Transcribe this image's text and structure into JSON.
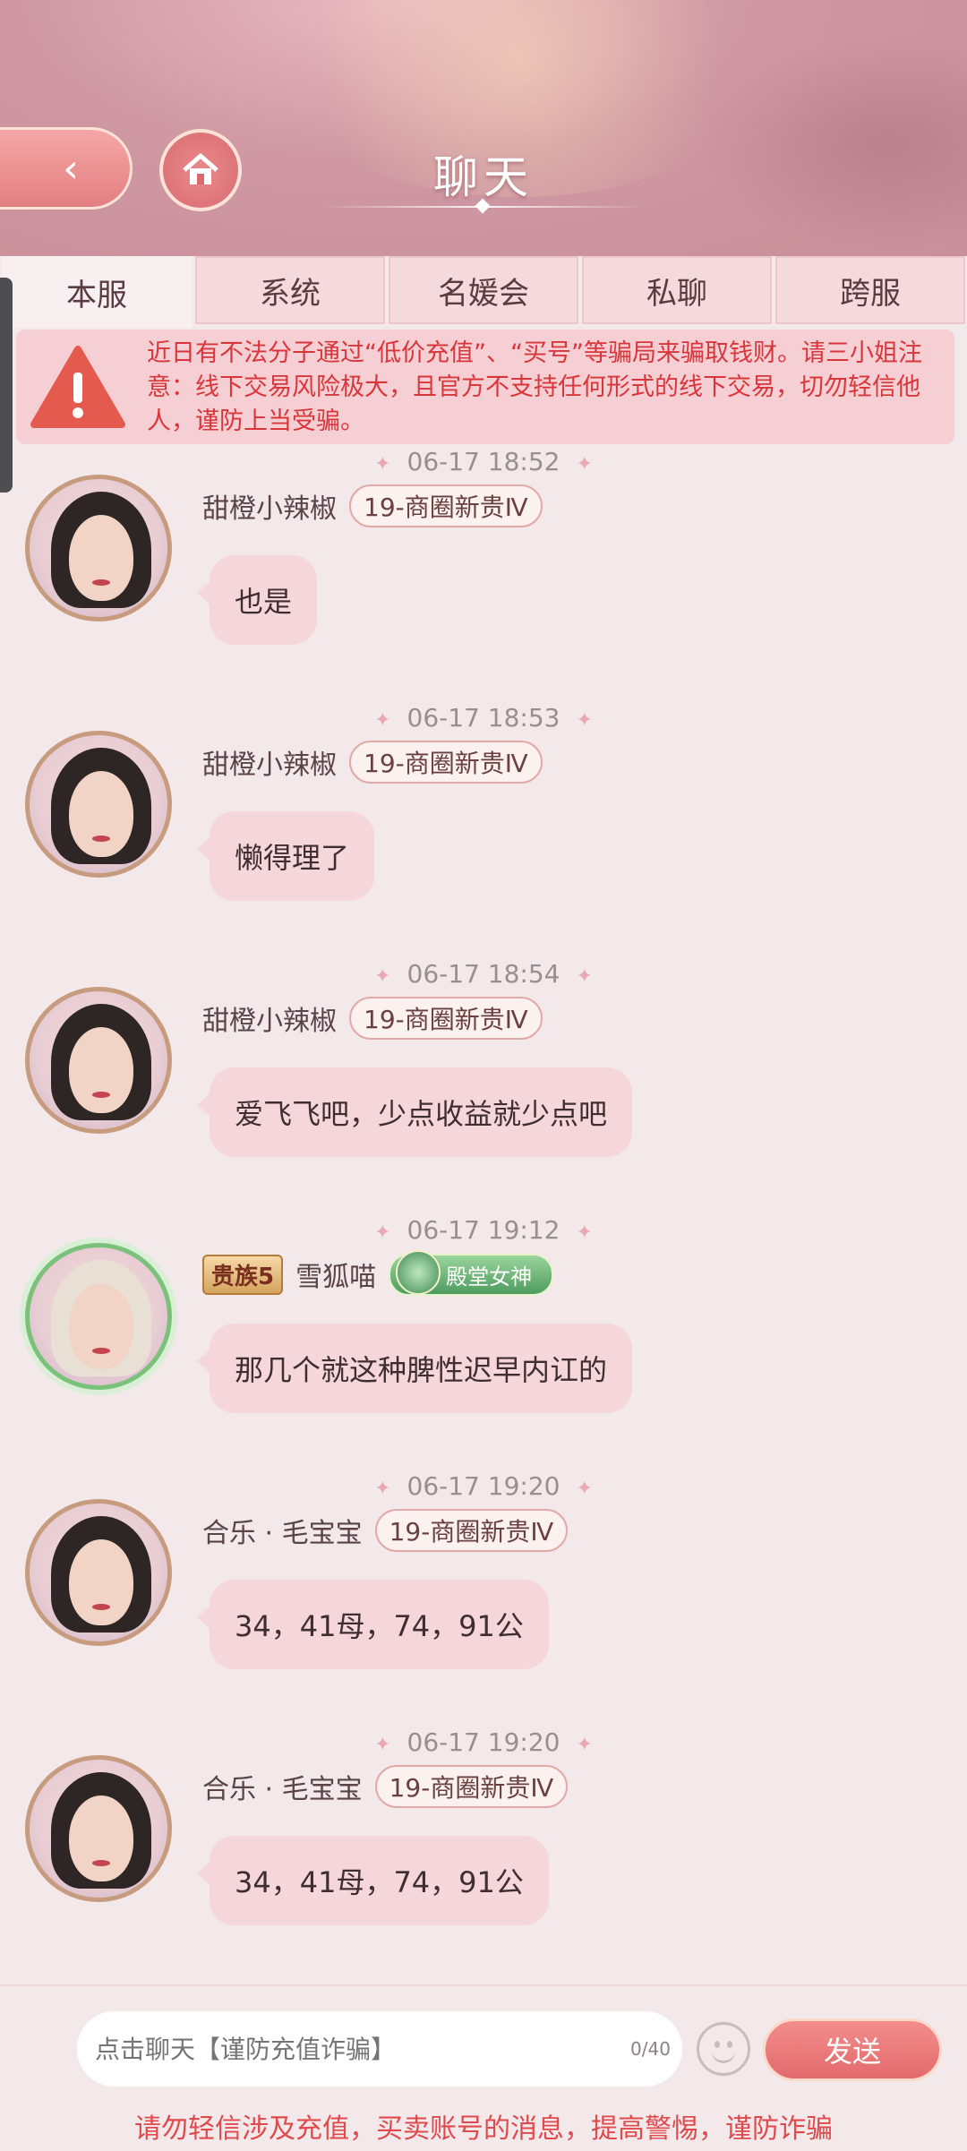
{
  "header": {
    "title": "聊天"
  },
  "tabs": [
    "本服",
    "系统",
    "名媛会",
    "私聊",
    "跨服"
  ],
  "warning": {
    "text": "近日有不法分子通过“低价充值”、“买号”等骗局来骗取钱财。请三小姐注意：线下交易风险极大，且官方不支持任何形式的线下交易，切勿轻信他人，谨防上当受骗。"
  },
  "messages": [
    {
      "time": "06-17 18:52",
      "name": "甜橙小辣椒",
      "rank": "19-商圈新贵Ⅳ",
      "text": "也是"
    },
    {
      "time": "06-17 18:53",
      "name": "甜橙小辣椒",
      "rank": "19-商圈新贵Ⅳ",
      "text": "懒得理了"
    },
    {
      "time": "06-17 18:54",
      "name": "甜橙小辣椒",
      "rank": "19-商圈新贵Ⅳ",
      "text": "爱飞飞吧，少点收益就少点吧"
    },
    {
      "time": "06-17 19:12",
      "guild": "贵族5",
      "name": "雪狐喵",
      "title_badge": "殿堂女神",
      "text": "那几个就这种脾性迟早内讧的"
    },
    {
      "time": "06-17 19:20",
      "name": "合乐 · 毛宝宝",
      "rank": "19-商圈新贵Ⅳ",
      "text": "34，41母，74，91公"
    },
    {
      "time": "06-17 19:20",
      "name": "合乐 · 毛宝宝",
      "rank": "19-商圈新贵Ⅳ",
      "text": "34，41母，74，91公"
    }
  ],
  "input": {
    "placeholder": "点击聊天【谨防充值诈骗】",
    "counter": "0/40",
    "send_label": "发送"
  },
  "footer": {
    "warning": "请勿轻信涉及充值，买卖账号的消息，提高警惕，谨防诈骗"
  }
}
